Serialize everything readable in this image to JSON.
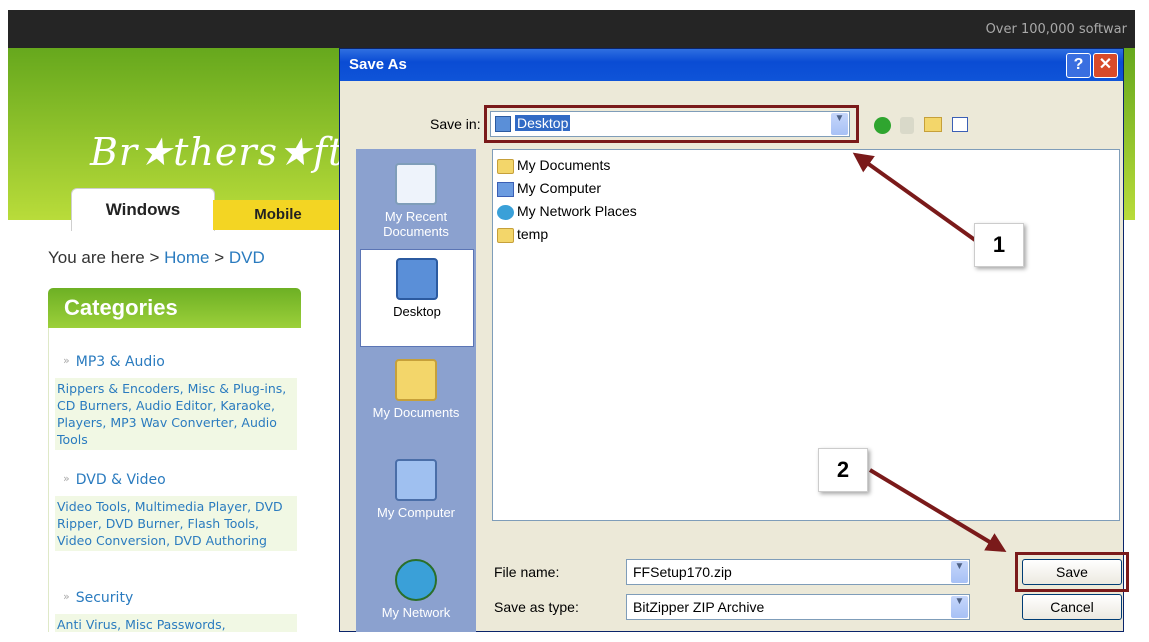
{
  "website": {
    "tagline": "Over 100,000 softwar",
    "logo_text": "Br★thers★ft",
    "tabs": [
      "Windows",
      "Mobile"
    ],
    "breadcrumb_prefix": "You are here >",
    "breadcrumb_home": "Home",
    "breadcrumb_sep": ">",
    "breadcrumb_current": "DVD",
    "categories_title": "Categories",
    "categories": [
      {
        "title": "MP3 & Audio",
        "items": "Rippers & Encoders, Misc & Plug-ins, CD Burners, Audio Editor, Karaoke, Players, MP3 Wav Converter, Audio Tools"
      },
      {
        "title": "DVD & Video",
        "items": "Video Tools, Multimedia Player, DVD Ripper, DVD Burner, Flash Tools, Video Conversion, DVD Authoring"
      },
      {
        "title": "Security",
        "items": "Anti Virus, Misc Passwords, Keylogger, Firewalls"
      }
    ]
  },
  "dialog": {
    "title": "Save As",
    "help_label": "?",
    "close_label": "✕",
    "save_in_label": "Save in:",
    "save_in_value": "Desktop",
    "places": [
      "My Recent Documents",
      "Desktop",
      "My Documents",
      "My Computer",
      "My Network"
    ],
    "files": [
      "My Documents",
      "My Computer",
      "My Network Places",
      "temp"
    ],
    "file_name_label": "File name:",
    "file_name_value": "FFSetup170.zip",
    "save_as_type_label": "Save as type:",
    "save_as_type_value": "BitZipper ZIP Archive",
    "save_button": "Save",
    "cancel_button": "Cancel"
  },
  "annotations": {
    "callout_1": "1",
    "callout_2": "2",
    "accent_color": "#7a1a1a"
  },
  "icons": [
    "back-icon",
    "up-folder-icon",
    "new-folder-icon",
    "views-menu-icon",
    "desktop-icon",
    "recent-documents-icon",
    "my-documents-icon",
    "my-computer-icon",
    "network-icon",
    "folder-icon"
  ]
}
